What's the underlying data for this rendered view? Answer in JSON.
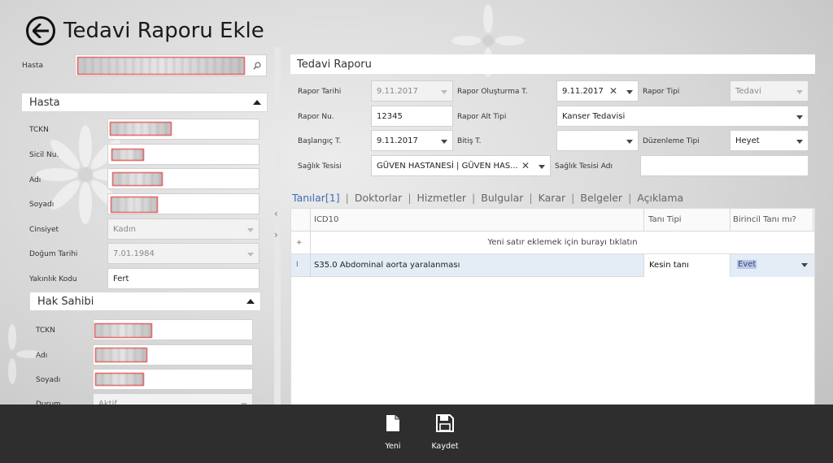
{
  "header": {
    "title": "Tedavi Raporu Ekle",
    "back_icon": "arrow-left-icon"
  },
  "patient": {
    "label": "Hasta",
    "value": "",
    "search_icon": "search-icon"
  },
  "hasta_section": {
    "title": "Hasta",
    "fields": {
      "tckn": {
        "label": "TCKN",
        "value": ""
      },
      "sicil": {
        "label": "Sicil Nu.",
        "value": ""
      },
      "adi": {
        "label": "Adı",
        "value": ""
      },
      "soyadi": {
        "label": "Soyadı",
        "value": ""
      },
      "cinsiyet": {
        "label": "Cinsiyet",
        "value": "Kadın"
      },
      "dogum": {
        "label": "Doğum Tarihi",
        "value": "7.01.1984"
      },
      "yakinlik": {
        "label": "Yakınlık Kodu",
        "value": "Fert"
      }
    }
  },
  "hak_sahibi": {
    "title": "Hak Sahibi",
    "fields": {
      "tckn": {
        "label": "TCKN",
        "value": ""
      },
      "adi": {
        "label": "Adı",
        "value": ""
      },
      "soyadi": {
        "label": "Soyadı",
        "value": ""
      },
      "durum": {
        "label": "Durum",
        "value": "Aktif"
      }
    }
  },
  "rapor": {
    "panel_title": "Tedavi Raporu",
    "rapor_tarihi": {
      "label": "Rapor Tarihi",
      "value": "9.11.2017"
    },
    "olusturma": {
      "label": "Rapor Oluşturma T.",
      "value": "9.11.2017"
    },
    "rapor_tipi": {
      "label": "Rapor Tipi",
      "value": "Tedavi"
    },
    "rapor_nu": {
      "label": "Rapor Nu.",
      "value": "12345"
    },
    "alt_tipi": {
      "label": "Rapor Alt Tipi",
      "value": "Kanser Tedavisi"
    },
    "baslangic": {
      "label": "Başlangıç T.",
      "value": "9.11.2017"
    },
    "bitis": {
      "label": "Bitiş T.",
      "value": ""
    },
    "duzenleme": {
      "label": "Düzenleme Tipi",
      "value": "Heyet"
    },
    "tesis": {
      "label": "Sağlık Tesisi",
      "value": "GÜVEN HASTANESİ | GÜVEN HAS..."
    },
    "tesis_adi": {
      "label": "Sağlık Tesisi Adı",
      "value": ""
    }
  },
  "tabs": [
    "Tanılar[1]",
    "Doktorlar",
    "Hizmetler",
    "Bulgular",
    "Karar",
    "Belgeler",
    "Açıklama"
  ],
  "grid": {
    "columns": [
      "ICD10",
      "Tanı Tipi",
      "Birincil Tanı mı?"
    ],
    "new_row_text": "Yeni satır eklemek için burayı tıklatın",
    "new_row_marker": "+",
    "row_marker": "I",
    "rows": [
      {
        "icd10": "S35.0 Abdominal aorta yaralanması",
        "tani_tipi": "Kesin tanı",
        "birincil": "Evet"
      }
    ]
  },
  "appbar": {
    "new": {
      "label": "Yeni",
      "icon": "document-icon"
    },
    "save": {
      "label": "Kaydet",
      "icon": "save-icon"
    }
  },
  "colors": {
    "accent_tab": "#3c6fb0",
    "appbar_bg": "#2e2e2e",
    "selected_row": "#e4ecf6",
    "mask_border": "#e02020"
  }
}
